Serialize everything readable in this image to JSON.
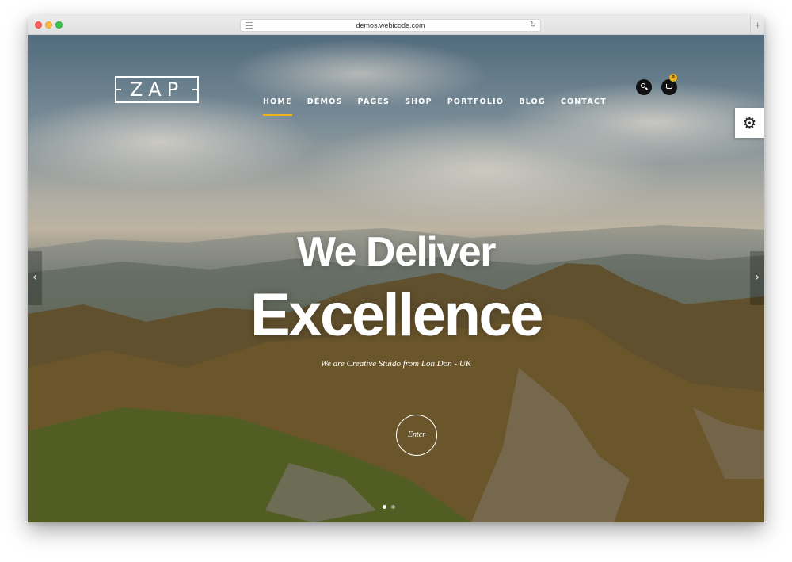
{
  "browser": {
    "url": "demos.webicode.com",
    "reload_icon": "reload-icon",
    "newtab_symbol": "+"
  },
  "site": {
    "logo_text": "ZAP",
    "nav": [
      {
        "label": "HOME",
        "active": true
      },
      {
        "label": "DEMOS",
        "active": false
      },
      {
        "label": "PAGES",
        "active": false
      },
      {
        "label": "SHOP",
        "active": false
      },
      {
        "label": "PORTFOLIO",
        "active": false
      },
      {
        "label": "BLOG",
        "active": false
      },
      {
        "label": "CONTACT",
        "active": false
      }
    ],
    "cart_count": "0",
    "settings_icon": "⚙",
    "accent_color": "#f1b31c"
  },
  "hero": {
    "headline_line1": "We Deliver",
    "headline_line2": "Excellence",
    "tagline": "We are Creative Stuido from Lon Don - UK",
    "enter_label": "Enter",
    "prev_arrow": "‹",
    "next_arrow": "›",
    "slides_total": 2,
    "active_slide": 1
  }
}
